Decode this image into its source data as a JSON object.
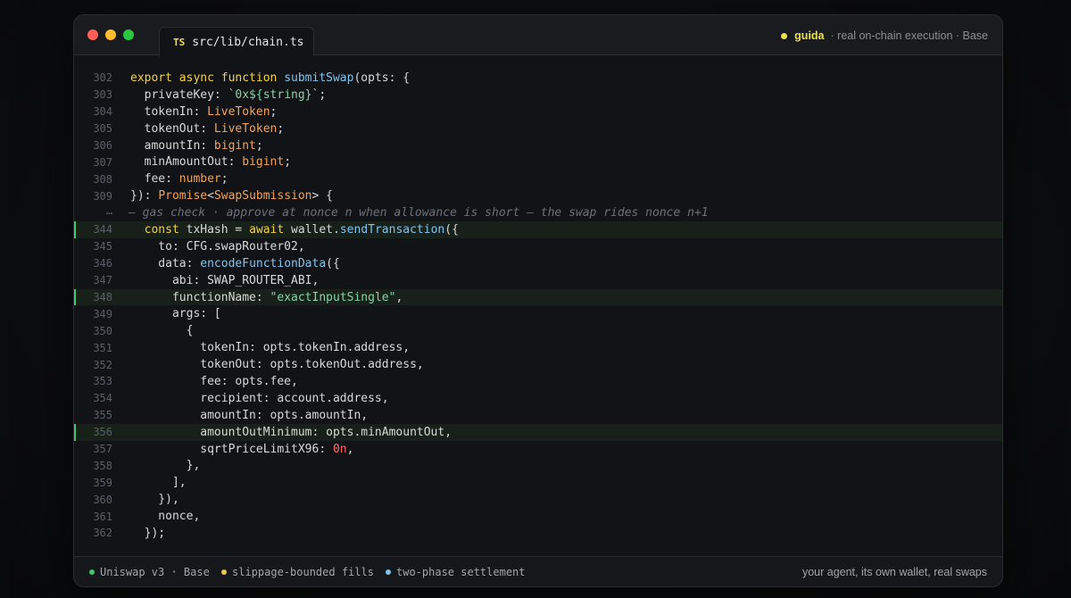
{
  "window": {
    "tab_lang": "TS",
    "tab_title": "src/lib/chain.ts",
    "brand_name": "guida",
    "brand_subtitle": "· real on-chain execution · Base"
  },
  "colors": {
    "keyword": "#f2d34a",
    "function": "#82c4ef",
    "type": "#f0a35e",
    "string": "#84d5a3",
    "number": "#ff6b6b",
    "highlight_bar": "#3ec86b",
    "brand": "#e9e34a"
  },
  "code_lines": [
    {
      "ln": "302",
      "tokens": [
        [
          "kw",
          "export async function "
        ],
        [
          "fn",
          "submitSwap"
        ],
        [
          "p",
          "(opts: {"
        ]
      ]
    },
    {
      "ln": "303",
      "tokens": [
        [
          "p",
          "  privateKey: "
        ],
        [
          "st",
          "`0x${string}`"
        ],
        [
          "p",
          ";"
        ]
      ]
    },
    {
      "ln": "304",
      "tokens": [
        [
          "p",
          "  tokenIn: "
        ],
        [
          "ty",
          "LiveToken"
        ],
        [
          "p",
          ";"
        ]
      ]
    },
    {
      "ln": "305",
      "tokens": [
        [
          "p",
          "  tokenOut: "
        ],
        [
          "ty",
          "LiveToken"
        ],
        [
          "p",
          ";"
        ]
      ]
    },
    {
      "ln": "306",
      "tokens": [
        [
          "p",
          "  amountIn: "
        ],
        [
          "ty",
          "bigint"
        ],
        [
          "p",
          ";"
        ]
      ]
    },
    {
      "ln": "307",
      "tokens": [
        [
          "p",
          "  minAmountOut: "
        ],
        [
          "ty",
          "bigint"
        ],
        [
          "p",
          ";"
        ]
      ]
    },
    {
      "ln": "308",
      "tokens": [
        [
          "p",
          "  fee: "
        ],
        [
          "ty",
          "number"
        ],
        [
          "p",
          ";"
        ]
      ]
    },
    {
      "ln": "309",
      "tokens": [
        [
          "p",
          "}): "
        ],
        [
          "ty",
          "Promise"
        ],
        [
          "p",
          "<"
        ],
        [
          "ty",
          "SwapSubmission"
        ],
        [
          "p",
          "> {"
        ]
      ]
    },
    {
      "ln": "⋯",
      "fold": true,
      "tokens": [
        [
          "cm",
          "— gas check · approve at nonce n when allowance is short — the swap rides nonce n+1"
        ]
      ]
    },
    {
      "ln": "344",
      "hl": true,
      "tokens": [
        [
          "p",
          "  "
        ],
        [
          "kw",
          "const "
        ],
        [
          "p",
          "txHash = "
        ],
        [
          "kw",
          "await "
        ],
        [
          "p",
          "wallet."
        ],
        [
          "fn",
          "sendTransaction"
        ],
        [
          "p",
          "({"
        ]
      ]
    },
    {
      "ln": "345",
      "tokens": [
        [
          "p",
          "    to: CFG.swapRouter02,"
        ]
      ]
    },
    {
      "ln": "346",
      "tokens": [
        [
          "p",
          "    data: "
        ],
        [
          "fn",
          "encodeFunctionData"
        ],
        [
          "p",
          "({"
        ]
      ]
    },
    {
      "ln": "347",
      "tokens": [
        [
          "p",
          "      abi: SWAP_ROUTER_ABI,"
        ]
      ]
    },
    {
      "ln": "348",
      "hl": true,
      "tokens": [
        [
          "p",
          "      functionName: "
        ],
        [
          "st",
          "\"exactInputSingle\""
        ],
        [
          "p",
          ","
        ]
      ]
    },
    {
      "ln": "349",
      "tokens": [
        [
          "p",
          "      args: ["
        ]
      ]
    },
    {
      "ln": "350",
      "tokens": [
        [
          "p",
          "        {"
        ]
      ]
    },
    {
      "ln": "351",
      "tokens": [
        [
          "p",
          "          tokenIn: opts.tokenIn.address,"
        ]
      ]
    },
    {
      "ln": "352",
      "tokens": [
        [
          "p",
          "          tokenOut: opts.tokenOut.address,"
        ]
      ]
    },
    {
      "ln": "353",
      "tokens": [
        [
          "p",
          "          fee: opts.fee,"
        ]
      ]
    },
    {
      "ln": "354",
      "tokens": [
        [
          "p",
          "          recipient: account.address,"
        ]
      ]
    },
    {
      "ln": "355",
      "tokens": [
        [
          "p",
          "          amountIn: opts.amountIn,"
        ]
      ]
    },
    {
      "ln": "356",
      "hl": true,
      "tokens": [
        [
          "p",
          "          amountOutMinimum: opts.minAmountOut,"
        ]
      ]
    },
    {
      "ln": "357",
      "tokens": [
        [
          "p",
          "          sqrtPriceLimitX96: "
        ],
        [
          "num",
          "0n"
        ],
        [
          "p",
          ","
        ]
      ]
    },
    {
      "ln": "358",
      "tokens": [
        [
          "p",
          "        },"
        ]
      ]
    },
    {
      "ln": "359",
      "tokens": [
        [
          "p",
          "      ],"
        ]
      ]
    },
    {
      "ln": "360",
      "tokens": [
        [
          "p",
          "    }),"
        ]
      ]
    },
    {
      "ln": "361",
      "tokens": [
        [
          "p",
          "    nonce,"
        ]
      ]
    },
    {
      "ln": "362",
      "tokens": [
        [
          "p",
          "  });"
        ]
      ]
    }
  ],
  "footer": {
    "items": [
      {
        "label": "Uniswap v3 · Base",
        "color": "#3ec86b"
      },
      {
        "label": "slippage-bounded fills",
        "color": "#e9c84a"
      },
      {
        "label": "two-phase settlement",
        "color": "#7cc4f0"
      }
    ],
    "right_text": "your agent, its own wallet, real swaps"
  }
}
